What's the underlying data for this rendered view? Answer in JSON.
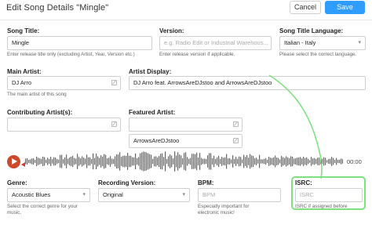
{
  "header": {
    "title": "Edit Song Details \"Mingle\"",
    "cancel_label": "Cancel",
    "save_label": "Save"
  },
  "song_title": {
    "label": "Song Title:",
    "value": "Mingle",
    "help": "Enter release title only (excluding Artist, Year, Version etc.)"
  },
  "version": {
    "label": "Version:",
    "placeholder": "e.g. Radio Edit or Industrial Warehous...",
    "help": "Enter release version if applicable."
  },
  "language": {
    "label": "Song Title Language:",
    "value": "Italian - Italy",
    "help": "Please select the correct language."
  },
  "main_artist": {
    "label": "Main Artist:",
    "value": "DJ Arro",
    "help": "The main artist of this song"
  },
  "artist_display": {
    "label": "Artist Display:",
    "value": "DJ Arro feat. ArrowsAreDJstoo and ArrowsAreDJstoo"
  },
  "contributing": {
    "label": "Contributing Artist(s):",
    "value": ""
  },
  "featured": {
    "label": "Featured Artist:",
    "value": "ArrowsAreDJstoo"
  },
  "player": {
    "time": "00:00"
  },
  "genre": {
    "label": "Genre:",
    "value": "Acoustic Blues",
    "help": [
      "Select the correct genre for your",
      "music."
    ]
  },
  "recording_version": {
    "label": "Recording Version:",
    "value": "Original"
  },
  "bpm": {
    "label": "BPM:",
    "placeholder": "BPM",
    "help": [
      "Especially important for",
      "electronic music!"
    ]
  },
  "isrc": {
    "label": "ISRC:",
    "placeholder": "ISRC",
    "help": "ISRC if assigned before"
  },
  "colors": {
    "save": "#2f9cff",
    "play": "#cc4a2a",
    "highlight": "#7ee07e"
  }
}
